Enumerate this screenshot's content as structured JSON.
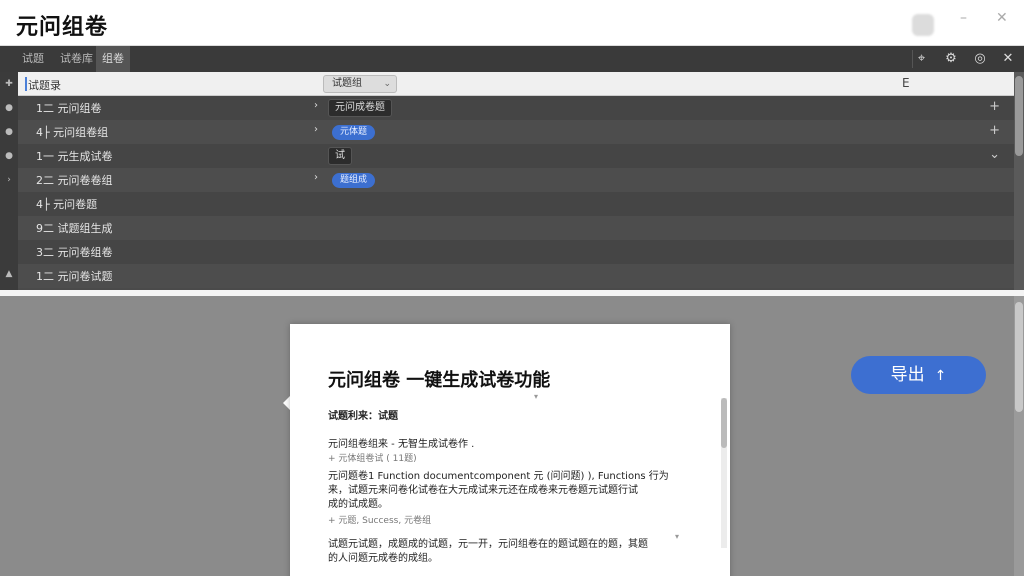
{
  "window": {
    "title": "元问组卷",
    "minimize_glyph": "–",
    "close_glyph": "✕"
  },
  "toolbar": {
    "tabs": [
      "试题",
      "试卷库",
      "组卷"
    ],
    "icons": [
      "crosshair-icon",
      "gear-icon",
      "target-icon",
      "close-icon"
    ]
  },
  "panel": {
    "header": {
      "label": "试题录",
      "select_value": "试题组",
      "right_label": "E"
    },
    "gutter_icons": [
      "plus-icon",
      "circle-icon",
      "circle-icon",
      "circle-icon",
      "chevron-right-icon",
      "arrow-up-icon"
    ],
    "rows": [
      {
        "label": "1二 元问组卷",
        "arrow": "›",
        "tag": "元问成卷题",
        "tag_style": "dark",
        "right": "+"
      },
      {
        "label": "4├ 元问组卷组",
        "arrow": "›",
        "tag": "元体题",
        "tag_style": "blue",
        "right": "+"
      },
      {
        "label": "1一 元生成试卷",
        "arrow": "",
        "tag": "试",
        "tag_style": "dark",
        "right": "⌄"
      },
      {
        "label": "2二 元问卷卷组",
        "arrow": "›",
        "tag": "题组成",
        "tag_style": "blue",
        "right": ""
      },
      {
        "label": "4├ 元问卷题",
        "arrow": "",
        "tag": "",
        "tag_style": "",
        "right": ""
      },
      {
        "label": "9二 试题组生成",
        "arrow": "",
        "tag": "",
        "tag_style": "",
        "right": ""
      },
      {
        "label": "3二 元问卷组卷",
        "arrow": "",
        "tag": "",
        "tag_style": "",
        "right": ""
      },
      {
        "label": "1二 元问卷试题",
        "arrow": "",
        "tag": "",
        "tag_style": "",
        "right": ""
      }
    ]
  },
  "document": {
    "title": "元问组卷 一键生成试卷功能",
    "lines": [
      {
        "text": "试题利来：试题",
        "style": "bold"
      },
      {
        "text": "元问组卷组来 - 无智生成试卷作 .",
        "style": "normal"
      },
      {
        "text": "+ 元体组卷试 ( 11题)",
        "style": "small"
      },
      {
        "text": "元问题卷1 Function documentcomponent 元 (问问题) ), Functions 行为",
        "style": "normal"
      },
      {
        "text": "来，试题元来问卷化试卷在大元成试来元还在成卷来元卷题元试题行试",
        "style": "normal"
      },
      {
        "text": "成的试成题。",
        "style": "normal"
      },
      {
        "text": "+ 元题, Success, 元卷组",
        "style": "small"
      },
      {
        "text": "试题元试题，成题成的试题，元一开，元问组卷在的题试题在的题，其题",
        "style": "normal"
      },
      {
        "text": "的人问题元成卷的成组。",
        "style": "normal"
      }
    ]
  },
  "export_button": {
    "label": "导出",
    "icon": "arrow-up-icon",
    "color": "#3d6fd1"
  }
}
